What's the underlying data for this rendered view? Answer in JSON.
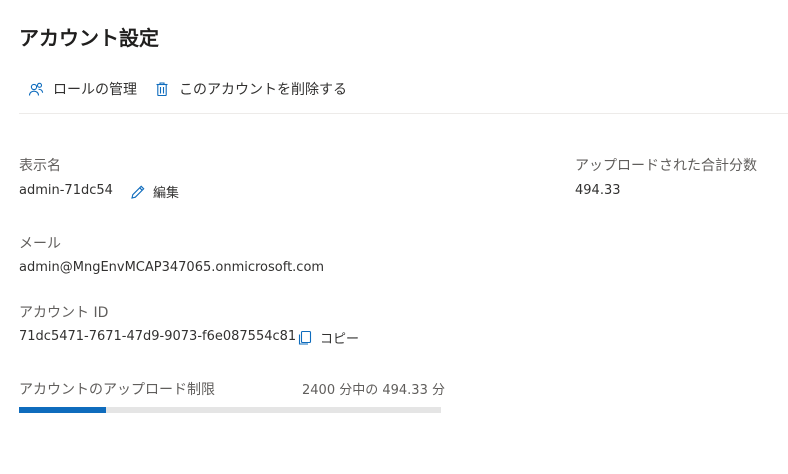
{
  "page": {
    "title": "アカウント設定"
  },
  "toolbar": {
    "roles_label": "ロールの管理",
    "delete_label": "このアカウントを削除する"
  },
  "display_name": {
    "label": "表示名",
    "value": "admin-71dc54",
    "edit_label": "編集"
  },
  "email": {
    "label": "メール",
    "value": "admin@MngEnvMCAP347065.onmicrosoft.com"
  },
  "account_id": {
    "label": "アカウント ID",
    "value": "71dc5471-7671-47d9-9073-f6e087554c81",
    "copy_label": "コピー"
  },
  "upload_limit": {
    "label": "アカウントのアップロード制限",
    "summary": "2400 分中の 494.33 分",
    "used_minutes": 494.33,
    "total_minutes": 2400
  },
  "uploaded_total": {
    "label": "アップロードされた合計分数",
    "value": "494.33"
  },
  "colors": {
    "accent": "#0f6cbd",
    "track": "#e5e5e5",
    "divider": "#edebe9"
  },
  "icons": {
    "roles": "people-icon",
    "delete": "trash-icon",
    "edit": "pencil-icon",
    "copy": "copy-icon"
  }
}
